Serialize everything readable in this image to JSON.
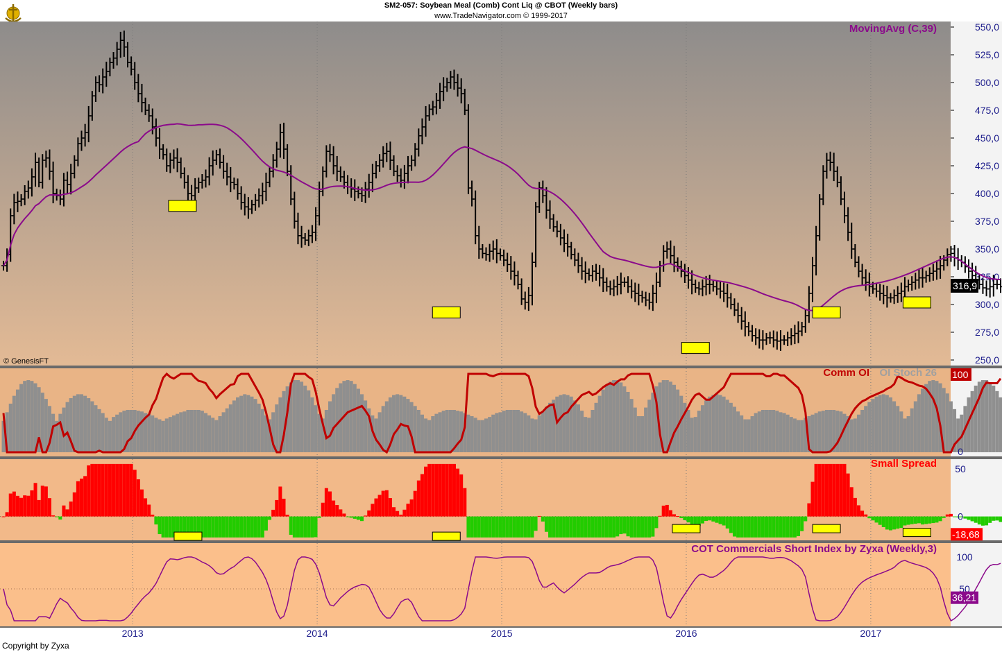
{
  "header": {
    "title": "SM2-057:  Soybean Meal (Comb) Cont Liq @ CBOT  (Weekly bars)",
    "subtitle": "www.TradeNavigator.com © 1999-2017"
  },
  "footer": {
    "credit": "Copyright by Zyxa"
  },
  "colors": {
    "price_bg_top": "#8e8c8b",
    "price_bg_bottom": "#e3ba95",
    "indicator_bg": "#f2b989",
    "cot_bg": "#fbbf8b",
    "moving_avg": "#8b0a8b",
    "comm_oi": "#c00000",
    "oi_bar": "#8f8f8f",
    "spread_pos": "#ff0000",
    "spread_neg": "#22cc00",
    "highlight": "#ffff00",
    "price_bar": "#000000",
    "axis_bg": "#f3f3f3"
  },
  "chart_data": [
    {
      "type": "ohlc",
      "panel": "price",
      "title": "MovingAvg (C,39)",
      "watermark": "© GenesisFT",
      "ylim": [
        245,
        555
      ],
      "yticks": [
        "550,0",
        "525,0",
        "500,0",
        "475,0",
        "450,0",
        "425,0",
        "400,0",
        "375,0",
        "350,0",
        "325,0",
        "300,0",
        "275,0",
        "250,0"
      ],
      "last_value_label": "316,9",
      "x_start": 2012.3,
      "x_step": 0.01923,
      "close": [
        335,
        345,
        380,
        392,
        393,
        395,
        402,
        405,
        415,
        428,
        410,
        430,
        432,
        420,
        400,
        398,
        395,
        412,
        408,
        418,
        430,
        445,
        450,
        455,
        470,
        488,
        500,
        498,
        505,
        510,
        518,
        522,
        530,
        538,
        532,
        518,
        512,
        500,
        490,
        482,
        475,
        470,
        460,
        450,
        440,
        435,
        425,
        430,
        432,
        428,
        418,
        410,
        400,
        398,
        405,
        410,
        412,
        415,
        425,
        430,
        435,
        428,
        420,
        415,
        410,
        408,
        400,
        392,
        388,
        386,
        390,
        394,
        398,
        402,
        410,
        420,
        430,
        440,
        455,
        440,
        420,
        395,
        375,
        362,
        360,
        358,
        362,
        365,
        380,
        402,
        420,
        438,
        435,
        425,
        420,
        415,
        410,
        406,
        404,
        402,
        400,
        398,
        404,
        410,
        418,
        425,
        430,
        436,
        438,
        430,
        420,
        416,
        412,
        418,
        425,
        430,
        440,
        452,
        460,
        470,
        476,
        478,
        484,
        492,
        496,
        500,
        505,
        500,
        495,
        490,
        475,
        405,
        395,
        362,
        350,
        346,
        345,
        348,
        350,
        346,
        344,
        340,
        336,
        330,
        326,
        318,
        305,
        302,
        308,
        338,
        388,
        405,
        398,
        385,
        377,
        370,
        366,
        360,
        355,
        352,
        345,
        340,
        335,
        330,
        328,
        326,
        330,
        328,
        324,
        320,
        316,
        314,
        316,
        318,
        320,
        320,
        316,
        312,
        310,
        308,
        306,
        304,
        302,
        310,
        320,
        335,
        348,
        350,
        344,
        338,
        334,
        330,
        326,
        322,
        318,
        315,
        314,
        316,
        318,
        318,
        316,
        314,
        312,
        310,
        306,
        300,
        295,
        290,
        285,
        280,
        276,
        272,
        270,
        268,
        268,
        270,
        270,
        268,
        267,
        268,
        268,
        270,
        272,
        274,
        276,
        280,
        290,
        310,
        335,
        362,
        395,
        420,
        430,
        428,
        420,
        410,
        395,
        380,
        365,
        350,
        338,
        330,
        324,
        320,
        316,
        314,
        312,
        310,
        308,
        306,
        306,
        308,
        310,
        312,
        316,
        318,
        320,
        322,
        324,
        324,
        326,
        328,
        330,
        332,
        335,
        340,
        345,
        346,
        342,
        340,
        338,
        334,
        330,
        326,
        322,
        318,
        315,
        314,
        316,
        318,
        318,
        316
      ],
      "ma": [],
      "highlight_boxes": [
        {
          "x": 2013.27,
          "y": 392
        },
        {
          "x": 2014.7,
          "y": 296
        },
        {
          "x": 2016.05,
          "y": 264
        },
        {
          "x": 2016.76,
          "y": 296
        },
        {
          "x": 2017.25,
          "y": 305
        }
      ]
    },
    {
      "type": "bar+line",
      "panel": "comm_oi",
      "labels": [
        "Comm OI",
        "OI Stoch 26"
      ],
      "ylim": [
        0,
        100
      ],
      "yticks": [
        "100",
        "0"
      ],
      "last_value_label": "100"
    },
    {
      "type": "bar",
      "panel": "small_spread",
      "title": "Small Spread",
      "ylim": [
        -25,
        60
      ],
      "yticks": [
        "50",
        "0"
      ],
      "last_value_label": "-18,68"
    },
    {
      "type": "line",
      "panel": "cot",
      "title": "COT Commercials Short Index by Zyxa (Weekly,3)",
      "ylim": [
        0,
        100
      ],
      "yticks": [
        "100",
        "50"
      ],
      "last_value_label": "36,21",
      "xticks": [
        "2013",
        "2014",
        "2015",
        "2016",
        "2017"
      ]
    }
  ]
}
